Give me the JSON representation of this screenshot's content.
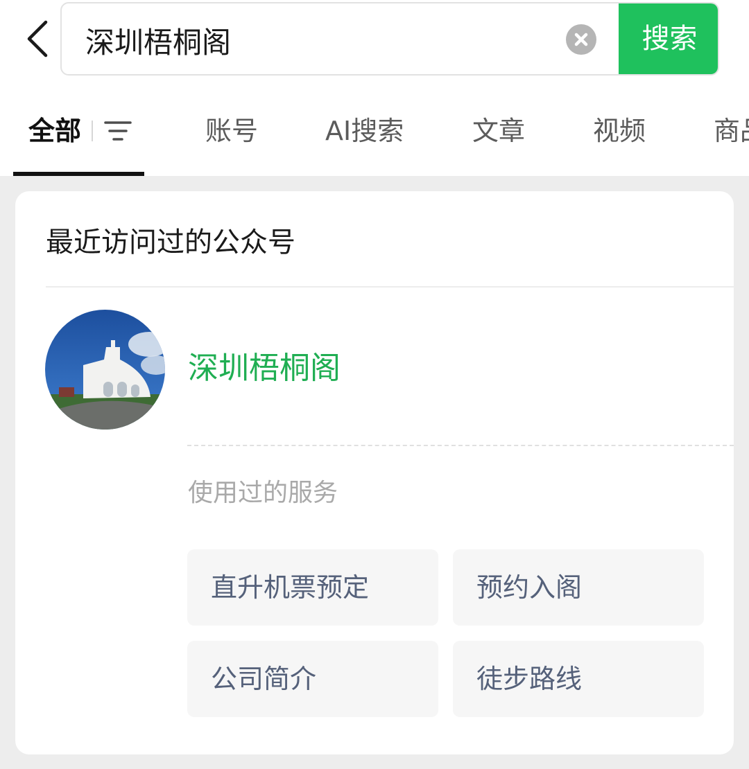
{
  "search": {
    "query": "深圳梧桐阁",
    "button_label": "搜索",
    "clear_icon": "clear-circle-icon",
    "back_icon": "chevron-left-icon"
  },
  "tabs": [
    {
      "label": "全部",
      "active": true
    },
    {
      "label": "账号",
      "active": false
    },
    {
      "label": "AI搜索",
      "active": false
    },
    {
      "label": "文章",
      "active": false
    },
    {
      "label": "视频",
      "active": false
    },
    {
      "label": "商品",
      "active": false
    }
  ],
  "filter_icon": "filter-icon",
  "recent": {
    "title": "最近访问过的公众号",
    "account": {
      "name": "深圳梧桐阁",
      "avatar": "avatar-photo"
    },
    "services_label": "使用过的服务",
    "services": [
      {
        "label": "直升机票预定"
      },
      {
        "label": "预约入阁"
      },
      {
        "label": "公司简介"
      },
      {
        "label": "徒步路线"
      }
    ]
  },
  "colors": {
    "accent_green": "#1fc15d",
    "account_name_green": "#1fae52",
    "service_text": "#55617a",
    "page_bg": "#ededed"
  }
}
